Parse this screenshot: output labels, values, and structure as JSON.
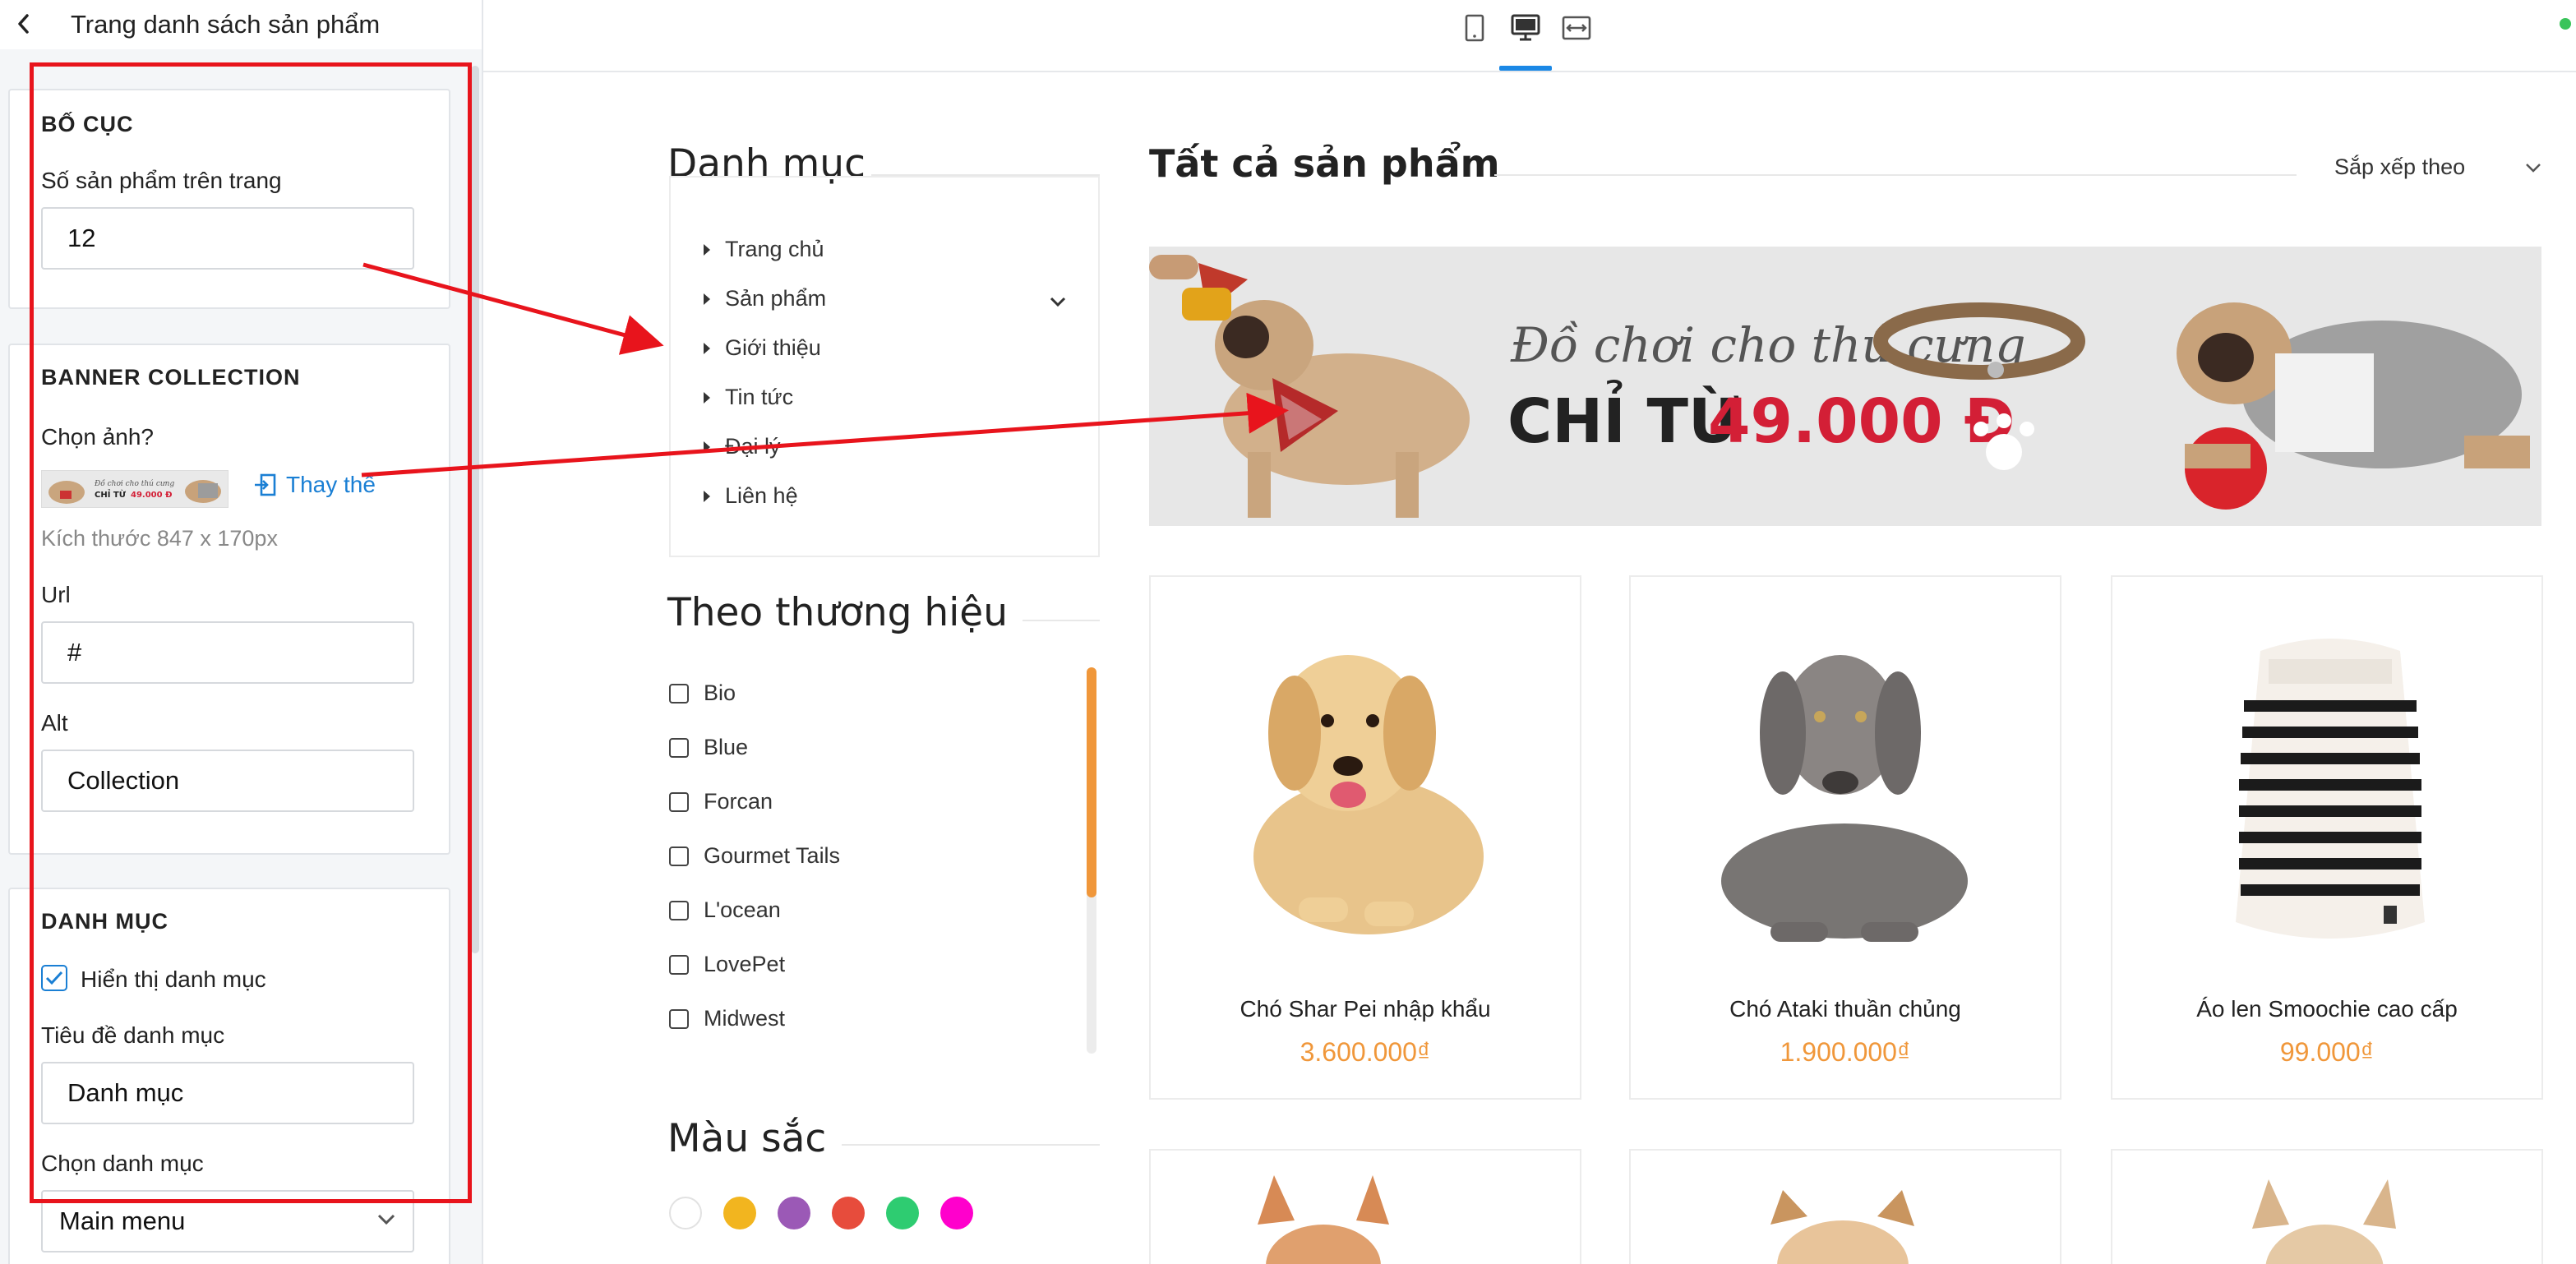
{
  "sidebar": {
    "title": "Trang danh sách sản phẩm",
    "layout": {
      "section_title": "BỐ CỤC",
      "per_page_label": "Số sản phẩm trên trang",
      "per_page_value": "12"
    },
    "banner": {
      "section_title": "BANNER COLLECTION",
      "choose_image_label": "Chọn ảnh?",
      "replace_label": "Thay thế",
      "size_hint": "Kích thước 847 x 170px",
      "url_label": "Url",
      "url_value": "#",
      "alt_label": "Alt",
      "alt_value": "Collection"
    },
    "category": {
      "section_title": "DANH MỤC",
      "show_label": "Hiển thị danh mục",
      "show_checked": true,
      "title_label": "Tiêu đề danh mục",
      "title_value": "Danh mục",
      "choose_label": "Chọn danh mục",
      "choose_value": "Main menu"
    }
  },
  "topbar": {
    "icons": [
      "mobile-icon",
      "desktop-icon",
      "fullwidth-icon"
    ],
    "active": "desktop-icon",
    "accent": "#1a88e6",
    "status_color": "#39c45a"
  },
  "store": {
    "category_title": "Danh mục",
    "categories": [
      "Trang chủ",
      "Sản phẩm",
      "Giới thiệu",
      "Tin tức",
      "Đại lý",
      "Liên hệ"
    ],
    "brand_title": "Theo thương hiệu",
    "brands": [
      "Bio",
      "Blue",
      "Forcan",
      "Gourmet Tails",
      "L'ocean",
      "LovePet",
      "Midwest"
    ],
    "color_title": "Màu sắc",
    "colors": [
      "#ffffff",
      "#f2b51f",
      "#9b59b6",
      "#e74c3c",
      "#2ecc71",
      "#ff00cc"
    ],
    "main_title": "Tất cả sản phẩm",
    "sort_label": "Sắp xếp theo",
    "banner": {
      "script_text": "Đồ chơi cho thú cưng",
      "prefix": "CHỈ TỪ",
      "price": "49.000 Đ"
    },
    "products": [
      {
        "name": "Chó Shar Pei nhập khẩu",
        "price": "3.600.000₫"
      },
      {
        "name": "Chó Ataki thuần chủng",
        "price": "1.900.000₫"
      },
      {
        "name": "Áo len Smoochie cao cấp",
        "price": "99.000₫"
      }
    ],
    "price_color": "#f0973a"
  },
  "annotation_color": "#e8141c"
}
